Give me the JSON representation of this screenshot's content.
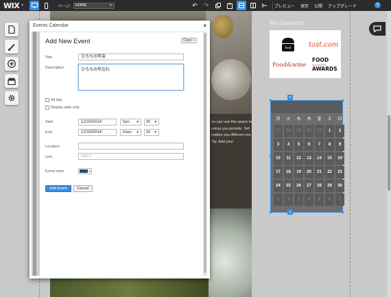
{
  "topbar": {
    "logo": "WIX",
    "page_label": "ページ:",
    "page_select": "HOME",
    "menu": [
      "プレビュー",
      "保存",
      "公開",
      "アップグレード"
    ],
    "help": "?"
  },
  "canvas": {
    "promo_text": "ou can use this space to rvices you provide. Tell makes you different ore. Tip: Add your"
  },
  "sponsors": {
    "title": "My Sponsors",
    "tast": "tast.com",
    "foodwine": "Food&wine",
    "awards_line1": "FOOD",
    "awards_line2": "AWARDS",
    "awards_small": "MAGAZINE"
  },
  "calendar": {
    "weekdays": [
      "月",
      "火",
      "水",
      "木",
      "金",
      "土",
      "日"
    ],
    "days": [
      [
        "27",
        "28",
        "29",
        "30",
        "31",
        "1",
        "2"
      ],
      [
        "3",
        "4",
        "5",
        "6",
        "7",
        "8",
        "9"
      ],
      [
        "10",
        "11",
        "12",
        "13",
        "14",
        "15",
        "16"
      ],
      [
        "17",
        "18",
        "19",
        "20",
        "21",
        "22",
        "23"
      ],
      [
        "24",
        "25",
        "26",
        "27",
        "28",
        "29",
        "30"
      ],
      [
        "1",
        "2",
        "3",
        "4",
        "5",
        "6",
        "7"
      ]
    ],
    "muted_rows": {
      "first_until": 5,
      "last_row": true
    }
  },
  "dialog": {
    "window_title": "Events Calendar",
    "close_x": "×",
    "form_title": "Add New Event",
    "close_button": "Close »",
    "title_label": "Title",
    "title_value": "ひろちの年会",
    "description_label": "Description",
    "description_value": "ひろちの年忘れ",
    "all_day_label": "All day",
    "display_date_only_label": "Display date only",
    "start_label": "Start",
    "start_date": "12/10/2014",
    "start_hour": "7pm",
    "start_min": "00",
    "end_label": "End",
    "end_date": "12/10/2014",
    "end_hour": "10am",
    "end_min": "00",
    "location_label": "Location",
    "location_value": "",
    "link_label": "Link",
    "link_placeholder": "http://",
    "event_color_label": "Event color",
    "event_color": "#2e4a7a",
    "add_event_button": "Add Event",
    "cancel_button": "Cancel"
  },
  "colors": {
    "accent": "#3a8de0",
    "topbar": "#2b2b2b",
    "calendar_bg": "#6d6d6d"
  }
}
